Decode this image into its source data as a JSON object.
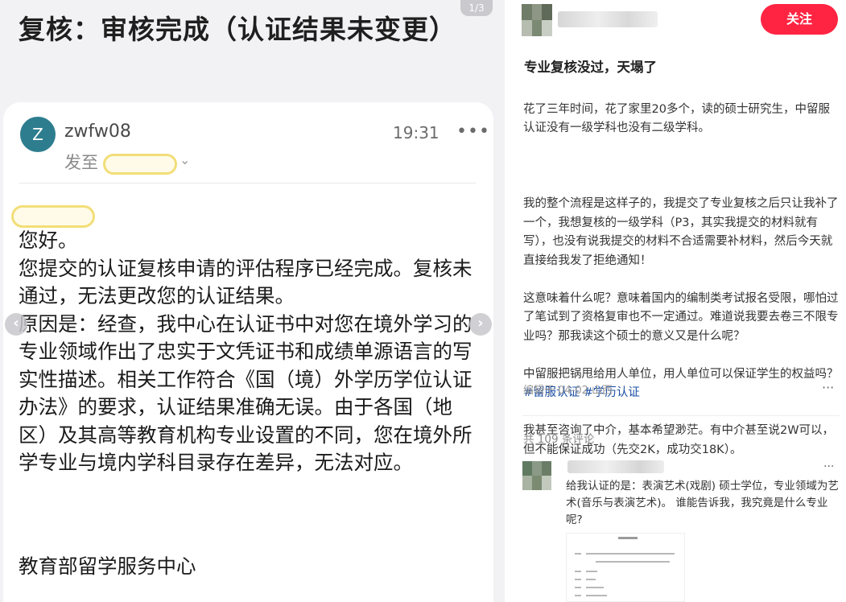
{
  "image_viewer": {
    "page_indicator": "1/3",
    "title": "复核：审核完成（认证结果未变更）",
    "email": {
      "avatar_letter": "Z",
      "sender": "zwfw08",
      "time": "19:31",
      "more": "•••",
      "to_label": "发至",
      "to_chevron": "⌄",
      "body": "您好。\n您提交的认证复核申请的评估程序已经完成。复核未通过，无法更改您的认证结果。\n原因是：经查，我中心在认证书中对您在境外学习的专业领域作出了忠实于文凭证书和成绩单源语言的写实性描述。相关工作符合《国（境）外学历学位认证办法》的要求，认证结果准确无误。由于各国（地区）及其高等教育机构专业设置的不同，您在境外所学专业与境内学科目录存在差异，无法对应。",
      "signature": "教育部留学服务中心"
    },
    "nav": {
      "prev": "‹",
      "next": "›"
    }
  },
  "post": {
    "follow_label": "关注",
    "title": "专业复核没过，天塌了",
    "paragraphs": [
      "花了三年时间，花了家里20多个，读的硕士研究生，中留服认证没有一级学科也没有二级学科。",
      "",
      "我的整个流程是这样子的，我提交了专业复核之后只让我补了一个，我想复核的一级学科（P3，其实我提交的材料就有写），也没有说我提交的材料不合适需要补材料，然后今天就直接给我发了拒绝通知！",
      "这意味着什么呢？意味着国内的编制类考试报名受限，哪怕过了笔试到了资格复审也不一定通过。难道说我要去卷三不限专业吗？那我读这个硕士的意义又是什么呢？",
      "中留服把锅甩给用人单位，用人单位可以保证学生的权益吗？",
      "我甚至咨询了中介，基本希望渺茫。有中介甚至说2W可以，但不能保证成功（先交2K，成功交18K）。"
    ],
    "tags": [
      "#留服认证",
      "#学历认证"
    ],
    "meta": "编辑于 04-02 山西",
    "more": "···",
    "comment_count": "共 109 条评论"
  },
  "comment": {
    "text": "给我认证的是：表演艺术(戏剧) 硕士学位，专业领域为艺术(音乐与表演艺术)。 谁能告诉我，我究竟是什么专业呢?",
    "more": "···"
  },
  "colors": {
    "brand": "#ff2442",
    "tag": "#1c4fa5",
    "email_avatar": "#2e7d8f",
    "redaction_outline": "#f2de78"
  },
  "icons": {
    "more": "more-dots-icon",
    "prev": "chevron-left-icon",
    "next": "chevron-right-icon"
  }
}
